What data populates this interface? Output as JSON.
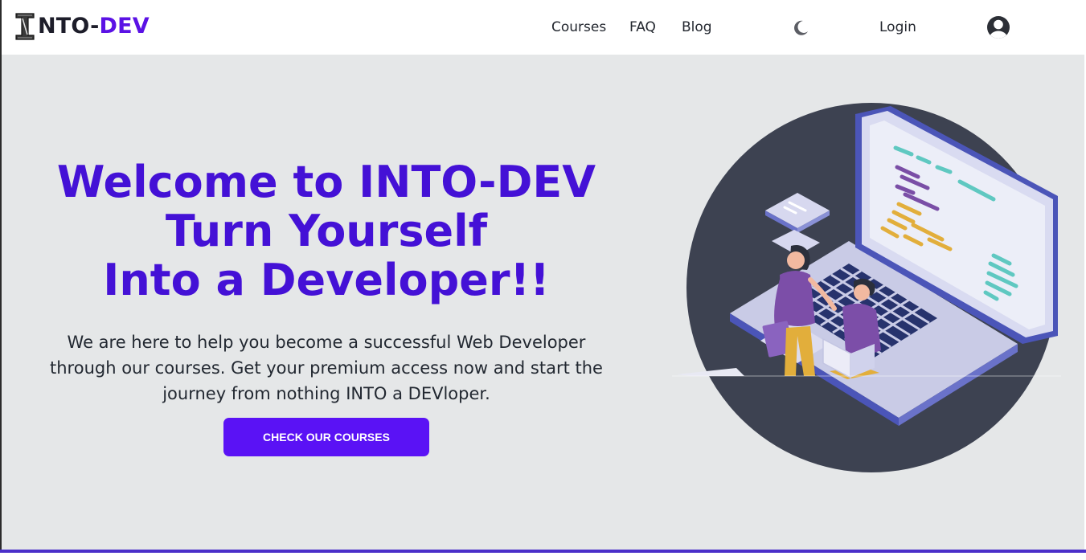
{
  "brand": {
    "logo_icon": "i-letter-icon",
    "name_prefix": "NTO-",
    "name_accent": "DEV",
    "accent_color": "#5b12e5"
  },
  "nav": {
    "links": [
      "Courses",
      "FAQ",
      "Blog"
    ],
    "theme_icon": "moon-icon",
    "login_label": "Login",
    "avatar_icon": "user-avatar-icon"
  },
  "hero": {
    "title_lines": [
      "Welcome to INTO-DEV",
      "Turn Yourself",
      "Into a Developer!!"
    ],
    "title_color": "#4411d6",
    "description": "We are here to help you become a successful Web Developer through our courses. Get your premium access now and start the journey from nothing INTO a DEVloper.",
    "cta_label": "CHECK OUR COURSES",
    "cta_color": "#5a12f5",
    "illustration": "developers-laptop-illustration"
  },
  "colors": {
    "page_background": "#e5e7e8",
    "header_background": "#ffffff",
    "footer_accent": "#4a2fc9"
  }
}
